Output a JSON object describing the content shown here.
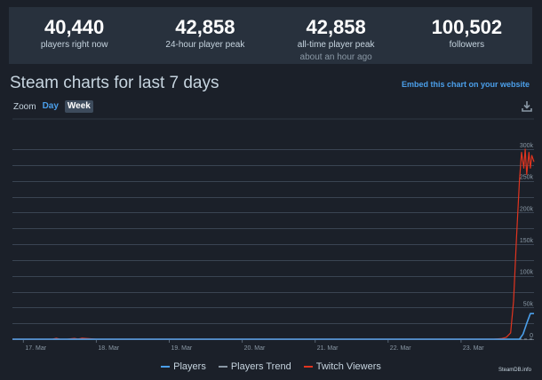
{
  "stats": [
    {
      "value": "40,440",
      "label": "players right now",
      "sub": ""
    },
    {
      "value": "42,858",
      "label": "24-hour player peak",
      "sub": ""
    },
    {
      "value": "42,858",
      "label": "all-time player peak",
      "sub": "about an hour ago"
    },
    {
      "value": "100,502",
      "label": "followers",
      "sub": ""
    }
  ],
  "title": "Steam charts for last 7 days",
  "embed_link": "Embed this chart on your website",
  "zoom": {
    "label": "Zoom",
    "day": "Day",
    "week": "Week",
    "active": "Week"
  },
  "icons": {
    "download": "download-icon"
  },
  "colors": {
    "background": "#1b2029",
    "panel": "#28313d",
    "players": "#4b9fea",
    "trend": "#8a98a5",
    "twitch": "#e0341f",
    "link": "#4b9fea"
  },
  "legend": [
    "Players",
    "Players Trend",
    "Twitch Viewers"
  ],
  "credit": "SteamDB.info",
  "chart_data": {
    "type": "line",
    "title": "",
    "xlabel": "",
    "ylabel": "",
    "x_ticks": [
      "17. Mar",
      "18. Mar",
      "19. Mar",
      "20. Mar",
      "21. Mar",
      "22. Mar",
      "23. Mar"
    ],
    "y_ticks": [
      "0",
      "50k",
      "100k",
      "150k",
      "200k",
      "250k",
      "300k"
    ],
    "xlim": [
      16.85,
      24.0
    ],
    "ylim": [
      0,
      300000
    ],
    "grid": true,
    "legend_position": "bottom",
    "series": [
      {
        "name": "Players",
        "x": [
          16.85,
          23.7,
          23.8,
          23.85,
          23.9,
          23.95,
          24.0
        ],
        "y": [
          0,
          0,
          0,
          8000,
          25000,
          40440,
          40440
        ]
      },
      {
        "name": "Players Trend",
        "x": [
          16.85,
          24.0
        ],
        "y": [
          0,
          0
        ]
      },
      {
        "name": "Twitch Viewers",
        "x": [
          16.85,
          17.4,
          17.45,
          17.5,
          17.6,
          17.7,
          17.75,
          17.8,
          18.0,
          23.45,
          23.55,
          23.62,
          23.68,
          23.72,
          23.76,
          23.8,
          23.83,
          23.86,
          23.88,
          23.9,
          23.93,
          23.95,
          23.97,
          24.0
        ],
        "y": [
          0,
          0,
          1500,
          0,
          0,
          1200,
          300,
          1500,
          0,
          0,
          800,
          3000,
          10000,
          60000,
          160000,
          250000,
          295000,
          270000,
          300000,
          260000,
          295000,
          270000,
          290000,
          280000
        ]
      }
    ]
  }
}
